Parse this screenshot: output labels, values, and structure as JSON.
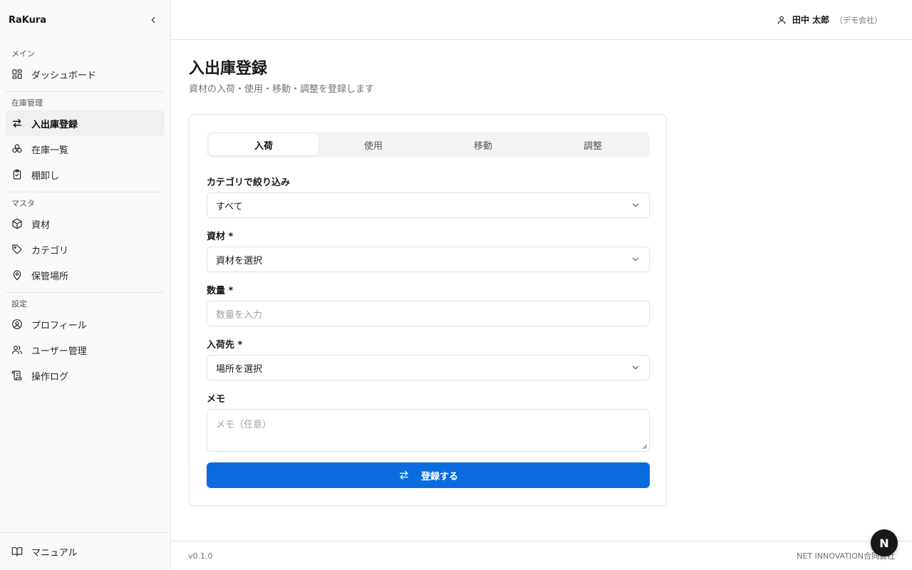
{
  "app": {
    "name": "RaKura"
  },
  "sidebar": {
    "groups": [
      {
        "label": "メイン",
        "items": [
          {
            "label": "ダッシュボード",
            "icon": "dashboard-icon"
          }
        ]
      },
      {
        "label": "在庫管理",
        "items": [
          {
            "label": "入出庫登録",
            "icon": "transfer-icon",
            "active": true
          },
          {
            "label": "在庫一覧",
            "icon": "boxes-icon"
          },
          {
            "label": "棚卸し",
            "icon": "clipboard-check-icon"
          }
        ]
      },
      {
        "label": "マスタ",
        "items": [
          {
            "label": "資材",
            "icon": "package-icon"
          },
          {
            "label": "カテゴリ",
            "icon": "tag-icon"
          },
          {
            "label": "保管場所",
            "icon": "map-pin-icon"
          }
        ]
      },
      {
        "label": "設定",
        "items": [
          {
            "label": "プロフィール",
            "icon": "user-circle-icon"
          },
          {
            "label": "ユーザー管理",
            "icon": "users-icon"
          },
          {
            "label": "操作ログ",
            "icon": "scroll-icon"
          }
        ]
      }
    ],
    "footer_item": {
      "label": "マニュアル",
      "icon": "book-icon"
    }
  },
  "header": {
    "user_name": "田中 太郎",
    "user_org": "（デモ会社）"
  },
  "page": {
    "title": "入出庫登録",
    "subtitle": "資材の入荷・使用・移動・調整を登録します"
  },
  "form": {
    "tabs": [
      "入荷",
      "使用",
      "移動",
      "調整"
    ],
    "active_tab": 0,
    "category": {
      "label": "カテゴリで絞り込み",
      "value": "すべて"
    },
    "material": {
      "label": "資材 *",
      "value": "資材を選択"
    },
    "quantity": {
      "label": "数量 *",
      "placeholder": "数量を入力"
    },
    "destination": {
      "label": "入荷先 *",
      "value": "場所を選択"
    },
    "memo": {
      "label": "メモ",
      "placeholder": "メモ（任意）"
    },
    "submit_label": "登録する"
  },
  "footer": {
    "version": "v0.1.0",
    "company": "NET INNOVATION合同会社"
  },
  "fab": {
    "label": "N"
  },
  "colors": {
    "primary": "#0a6bdf",
    "active_bg": "#f0f0f1"
  }
}
